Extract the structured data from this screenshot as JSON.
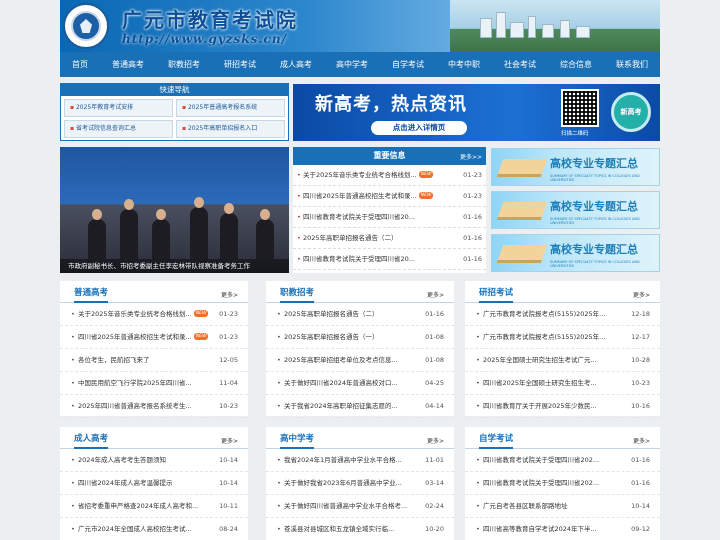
{
  "header": {
    "title": "广元市教育考试院",
    "url": "http://www.gyzsks.cn/"
  },
  "nav": [
    "首页",
    "普通高考",
    "职教招考",
    "研招考试",
    "成人高考",
    "高中学考",
    "自学考试",
    "中考中职",
    "社会考试",
    "综合信息",
    "联系我们"
  ],
  "quick_nav": {
    "title": "快速导航",
    "items": [
      "2025年教育考试安排",
      "2025年普通高考报名系统",
      "省考试院信息查询汇总",
      "2025年高职单招报名入口"
    ]
  },
  "banner": {
    "headline": "新高考，热点资讯",
    "button": "点击进入详情页",
    "qr_label": "扫描二维码",
    "circle_label": "新高考"
  },
  "photo": {
    "caption": "市政府副秘书长、市招考委副主任李宏林带队视察准备考务工作"
  },
  "important": {
    "title": "重要信息",
    "more": "更多>>",
    "items": [
      {
        "text": "关于2025年音乐类专业统考合格线划...",
        "date": "01-23",
        "new": "NEW"
      },
      {
        "text": "四川省2025年普通高校招生考试和录...",
        "date": "01-23",
        "new": "NEW"
      },
      {
        "text": "四川省教育考试院关于受理四川省20...",
        "date": "01-16",
        "new": ""
      },
      {
        "text": "2025年高职单招报名通告（二）",
        "date": "01-16",
        "new": ""
      },
      {
        "text": "四川省教育考试院关于受理四川省20...",
        "date": "01-16",
        "new": ""
      }
    ]
  },
  "promo": {
    "title": "高校专业专题汇总",
    "subtitle": "SUMMARY OF SPECIALTY TOPICS IN COLLEGES AND UNIVERSITIES"
  },
  "sections": [
    {
      "title": "普通高考",
      "more": "更多>",
      "items": [
        {
          "text": "关于2025年音乐类专业统考合格线划...",
          "date": "01-23",
          "new": "NEW"
        },
        {
          "text": "四川省2025年普通高校招生考试和录...",
          "date": "01-23",
          "new": "NEW"
        },
        {
          "text": "各位考生，民航招飞来了",
          "date": "12-05",
          "new": ""
        },
        {
          "text": "中国民用航空飞行学院2025年四川省...",
          "date": "11-04",
          "new": ""
        },
        {
          "text": "2025年四川省普通高考报名系统考生...",
          "date": "10-23",
          "new": ""
        }
      ]
    },
    {
      "title": "职教招考",
      "more": "更多>",
      "items": [
        {
          "text": "2025年高职单招报名通告（二）",
          "date": "01-16",
          "new": ""
        },
        {
          "text": "2025年高职单招报名通告（一）",
          "date": "01-08",
          "new": ""
        },
        {
          "text": "2025年高职单招组考单位及考点信息...",
          "date": "01-08",
          "new": ""
        },
        {
          "text": "关于做好四川省2024年普通高校对口...",
          "date": "04-25",
          "new": ""
        },
        {
          "text": "关于我省2024年高职单招征集志愿的...",
          "date": "04-14",
          "new": ""
        }
      ]
    },
    {
      "title": "研招考试",
      "more": "更多>",
      "items": [
        {
          "text": "广元市教育考试院报考点(5155)2025年...",
          "date": "12-18",
          "new": ""
        },
        {
          "text": "广元市教育考试院报考点(5155)2025年...",
          "date": "12-17",
          "new": ""
        },
        {
          "text": "2025年全国硕士研究生招生考试广元...",
          "date": "10-28",
          "new": ""
        },
        {
          "text": "四川省2025年全国硕士研究生招生考...",
          "date": "10-23",
          "new": ""
        },
        {
          "text": "四川省教育厅关于开展2025年少数民...",
          "date": "10-16",
          "new": ""
        }
      ]
    },
    {
      "title": "成人高考",
      "more": "更多>",
      "items": [
        {
          "text": "2024年成人高考考生答题须知",
          "date": "10-14",
          "new": ""
        },
        {
          "text": "四川省2024年成人高考温馨提示",
          "date": "10-14",
          "new": ""
        },
        {
          "text": "省招考委重申严格查2024年成人高考和...",
          "date": "10-11",
          "new": ""
        },
        {
          "text": "广元市2024年全国成人高校招生考试...",
          "date": "08-24",
          "new": ""
        }
      ]
    },
    {
      "title": "高中学考",
      "more": "更多>",
      "items": [
        {
          "text": "我省2024年1月普通高中学业水平合格...",
          "date": "11-01",
          "new": ""
        },
        {
          "text": "关于做好我省2023年6月普通高中学业...",
          "date": "03-14",
          "new": ""
        },
        {
          "text": "关于做好四川省普通高中学业水平合格考...",
          "date": "02-24",
          "new": ""
        },
        {
          "text": "苍溪县对县城区和五龙镇全域实行临...",
          "date": "10-20",
          "new": ""
        }
      ]
    },
    {
      "title": "自学考试",
      "more": "更多>",
      "items": [
        {
          "text": "四川省教育考试院关于受理四川省202...",
          "date": "01-16",
          "new": ""
        },
        {
          "text": "四川省教育考试院关于受理四川省202...",
          "date": "01-16",
          "new": ""
        },
        {
          "text": "广元自考各县区联系部路地址",
          "date": "10-14",
          "new": ""
        },
        {
          "text": "四川省高等教育自学考试2024年下半...",
          "date": "09-12",
          "new": ""
        }
      ]
    }
  ]
}
